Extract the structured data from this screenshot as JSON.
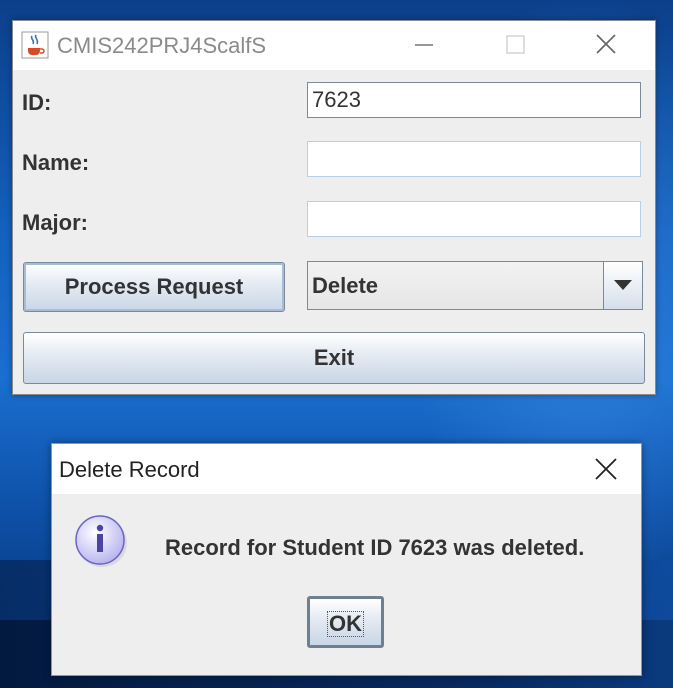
{
  "main_window": {
    "title": "CMIS242PRJ4ScalfS",
    "icons": {
      "app": "java-cup-icon",
      "minimize": "minimize-icon",
      "maximize": "maximize-icon",
      "close": "close-icon"
    },
    "form": {
      "id_label": "ID:",
      "id_value": "7623",
      "name_label": "Name:",
      "name_value": "",
      "major_label": "Major:",
      "major_value": ""
    },
    "process_button": "Process Request",
    "action_select": {
      "selected": "Delete"
    },
    "exit_button": "Exit"
  },
  "dialog": {
    "title": "Delete Record",
    "icon": "information-icon",
    "message": "Record for Student ID 7623 was deleted.",
    "ok_button": "OK"
  },
  "colors": {
    "window_bg": "#eeeeee",
    "titlebar_bg": "#ffffff",
    "desktop_blue": "#1462c0"
  }
}
